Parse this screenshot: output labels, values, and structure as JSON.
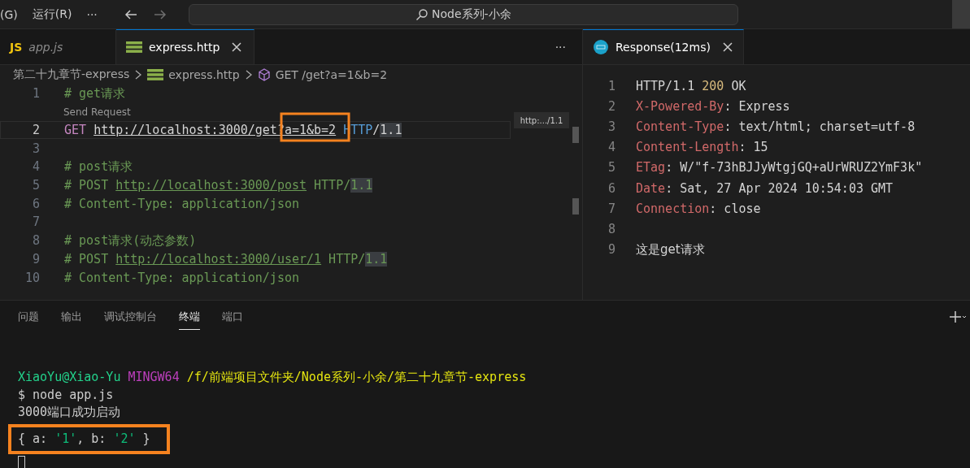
{
  "title_bar": {
    "menus": [
      "(G)",
      "运行(R)"
    ],
    "more": "···",
    "search": "Node系列-小余"
  },
  "editor": {
    "tabs": [
      {
        "kind": "js",
        "icon_text": "JS",
        "label": "app.js",
        "selected": false,
        "closable": false
      },
      {
        "kind": "http",
        "label": "express.http",
        "selected": true,
        "closable": true
      }
    ],
    "more": "···",
    "breadcrumb": {
      "folder": "第二十九章节-express",
      "file": "express.http",
      "symbol": "GET /get?a=1&b=2"
    },
    "minimap_hint": "http:.../1.1",
    "lines": [
      {
        "number": "1",
        "current": false,
        "tokens": [
          {
            "kind": "comment",
            "text": "# get请求"
          }
        ]
      },
      {
        "number": "2",
        "current": true,
        "lens": "Send Request",
        "tokens": [
          {
            "kind": "method",
            "text": "GET "
          },
          {
            "kind": "link",
            "text": "http://localhost:3000/get?a=1&b=2"
          },
          {
            "kind": "keyword",
            "text": " HTTP"
          },
          {
            "kind": "plain",
            "text": "/"
          },
          {
            "kind": "version",
            "text": "1.1"
          }
        ]
      },
      {
        "number": "3",
        "current": false
      },
      {
        "number": "4",
        "current": false,
        "tokens": [
          {
            "kind": "comment",
            "text": "# post请求"
          }
        ]
      },
      {
        "number": "5",
        "current": false,
        "tokens": [
          {
            "kind": "comment",
            "text": "# POST "
          },
          {
            "kind": "comment-link",
            "text": "http://localhost:3000/post"
          },
          {
            "kind": "comment",
            "text": " HTTP/"
          },
          {
            "kind": "comment-version",
            "text": "1.1"
          }
        ]
      },
      {
        "number": "6",
        "current": false,
        "tokens": [
          {
            "kind": "comment",
            "text": "# Content-Type: application/json"
          }
        ]
      },
      {
        "number": "7",
        "current": false
      },
      {
        "number": "8",
        "current": false,
        "tokens": [
          {
            "kind": "comment",
            "text": "# post请求(动态参数)"
          }
        ]
      },
      {
        "number": "9",
        "current": false,
        "tokens": [
          {
            "kind": "comment",
            "text": "# POST "
          },
          {
            "kind": "comment-link",
            "text": "http://localhost:3000/user/1"
          },
          {
            "kind": "comment",
            "text": " HTTP/"
          },
          {
            "kind": "comment-version",
            "text": "1.1"
          }
        ]
      },
      {
        "number": "10",
        "current": false,
        "tokens": [
          {
            "kind": "comment",
            "text": "# Content-Type: application/json"
          }
        ]
      }
    ]
  },
  "response": {
    "tab": {
      "label": "Response(12ms)",
      "selected": true
    },
    "lines": [
      {
        "number": "1",
        "tokens": [
          {
            "kind": "plain",
            "text": "HTTP/1.1 "
          },
          {
            "kind": "status",
            "text": "200"
          },
          {
            "kind": "plain",
            "text": " OK"
          }
        ]
      },
      {
        "number": "2",
        "tokens": [
          {
            "kind": "header",
            "text": "X-Powered-By"
          },
          {
            "kind": "plain",
            "text": ": Express"
          }
        ]
      },
      {
        "number": "3",
        "tokens": [
          {
            "kind": "header",
            "text": "Content-Type"
          },
          {
            "kind": "plain",
            "text": ": text/html; charset=utf-8"
          }
        ]
      },
      {
        "number": "4",
        "tokens": [
          {
            "kind": "header",
            "text": "Content-Length"
          },
          {
            "kind": "plain",
            "text": ": 15"
          }
        ]
      },
      {
        "number": "5",
        "tokens": [
          {
            "kind": "header",
            "text": "ETag"
          },
          {
            "kind": "plain",
            "text": ": W/\"f-73hBJJyWtgjGQ+aUrWRUZ2YmF3k\""
          }
        ]
      },
      {
        "number": "6",
        "tokens": [
          {
            "kind": "header",
            "text": "Date"
          },
          {
            "kind": "plain",
            "text": ": Sat, 27 Apr 2024 10:54:03 GMT"
          }
        ]
      },
      {
        "number": "7",
        "tokens": [
          {
            "kind": "header",
            "text": "Connection"
          },
          {
            "kind": "plain",
            "text": ": close"
          }
        ]
      },
      {
        "number": "8"
      },
      {
        "number": "9",
        "tokens": [
          {
            "kind": "body",
            "text": "这是get请求"
          }
        ]
      }
    ]
  },
  "panel": {
    "tabs": [
      {
        "label": "问题",
        "selected": false
      },
      {
        "label": "输出",
        "selected": false
      },
      {
        "label": "调试控制台",
        "selected": false
      },
      {
        "label": "终端",
        "selected": true
      },
      {
        "label": "端口",
        "selected": false
      }
    ],
    "terminal": [
      {
        "tokens": [
          {
            "kind": "user",
            "text": "XiaoYu@Xiao-Yu"
          },
          {
            "kind": "host",
            "text": " MINGW64"
          },
          {
            "kind": "path",
            "text": " /f/前端项目文件夹/Node系列-小余/第二十九章节-express"
          }
        ]
      },
      {
        "tokens": [
          {
            "kind": "plain",
            "text": "$ node app.js"
          }
        ]
      },
      {
        "tokens": [
          {
            "kind": "plain",
            "text": "3000端口成功启动"
          }
        ]
      },
      {
        "highlighted": true,
        "tokens": [
          {
            "kind": "plain",
            "text": "{ a: "
          },
          {
            "kind": "string",
            "text": "'1'"
          },
          {
            "kind": "plain",
            "text": ", b: "
          },
          {
            "kind": "string",
            "text": "'2'"
          },
          {
            "kind": "plain",
            "text": " }"
          }
        ]
      }
    ]
  }
}
